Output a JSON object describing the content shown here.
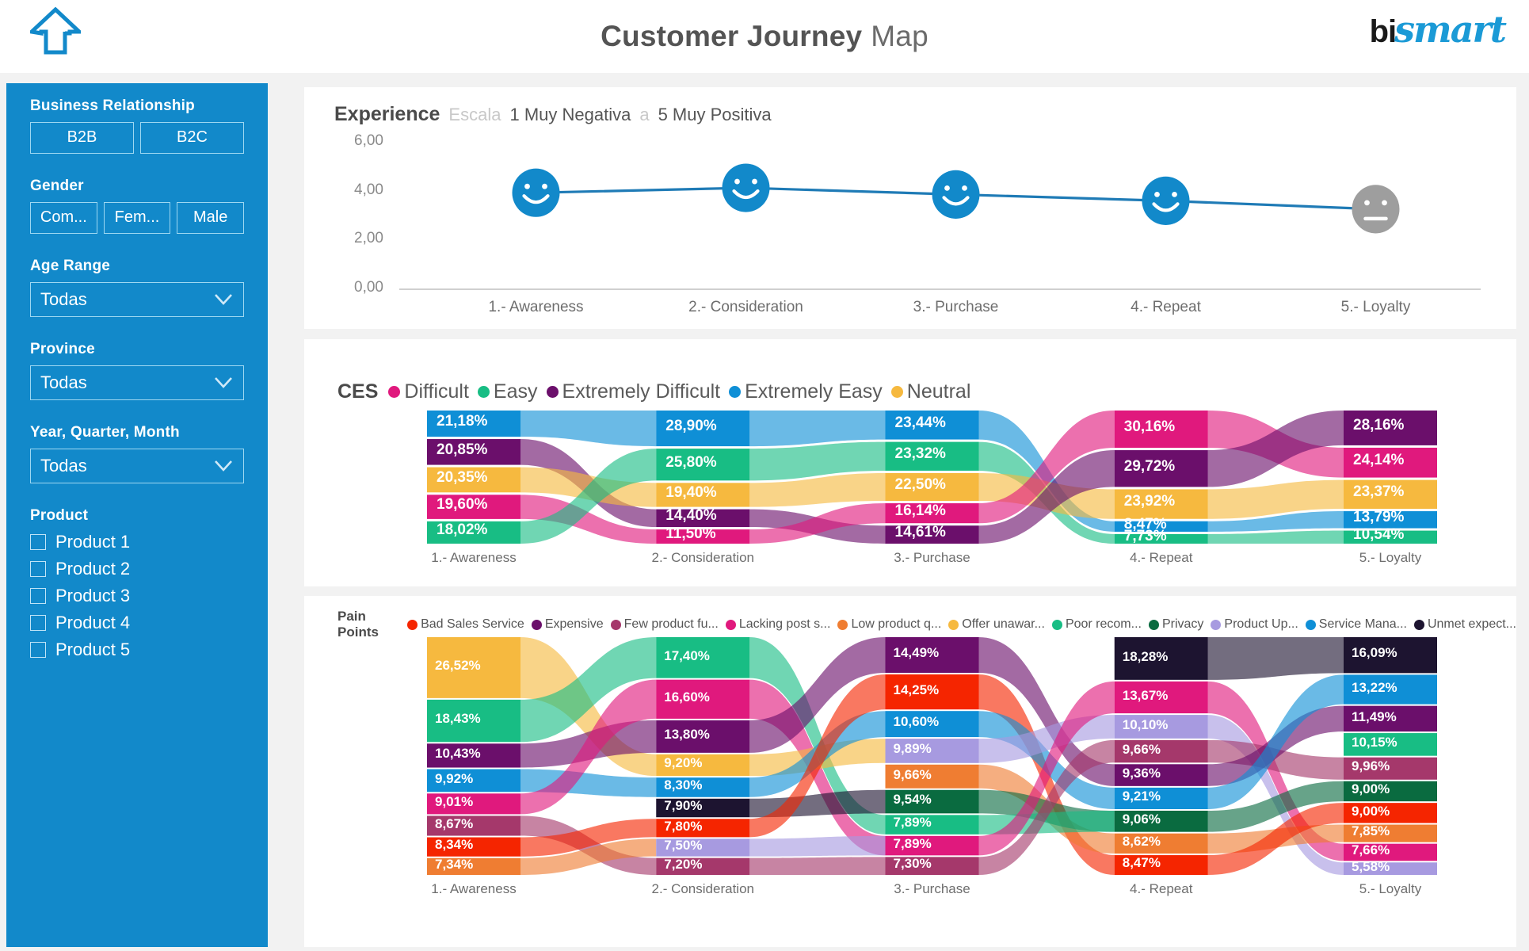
{
  "header": {
    "home_icon": "home-icon",
    "title_bold": "Customer Journey",
    "title_light": "Map",
    "logo_bi": "bi",
    "logo_smart": "smart"
  },
  "sidebar": {
    "business_relationship": {
      "label": "Business Relationship",
      "options": [
        "B2B",
        "B2C"
      ]
    },
    "gender": {
      "label": "Gender",
      "options": [
        "Com...",
        "Fem...",
        "Male"
      ]
    },
    "age_range": {
      "label": "Age Range",
      "value": "Todas",
      "icon": "chevron-down-icon"
    },
    "province": {
      "label": "Province",
      "value": "Todas",
      "icon": "chevron-down-icon"
    },
    "period": {
      "label": "Year, Quarter, Month",
      "value": "Todas",
      "icon": "chevron-down-icon"
    },
    "product": {
      "label": "Product",
      "items": [
        {
          "label": "Product 1",
          "checked": false
        },
        {
          "label": "Product 2",
          "checked": false
        },
        {
          "label": "Product 3",
          "checked": false
        },
        {
          "label": "Product 4",
          "checked": false
        },
        {
          "label": "Product 5",
          "checked": false
        }
      ]
    }
  },
  "experience": {
    "title": "Experience",
    "scale_word": "Escala",
    "scale_low": "1 Muy Negativa",
    "scale_sep": "a",
    "scale_high": "5 Muy Positiva"
  },
  "ces": {
    "title": "CES",
    "legend": [
      {
        "label": "Difficult",
        "color": "#e0197d"
      },
      {
        "label": "Easy",
        "color": "#18bd84"
      },
      {
        "label": "Extremely Difficult",
        "color": "#6b0f6b"
      },
      {
        "label": "Extremely Easy",
        "color": "#0f8fd6"
      },
      {
        "label": "Neutral",
        "color": "#f6b93f"
      }
    ]
  },
  "pain_points": {
    "title": "Pain Points",
    "legend": [
      {
        "label": "Bad Sales Service",
        "color": "#f52500"
      },
      {
        "label": "Expensive",
        "color": "#6b0f6b"
      },
      {
        "label": "Few product fu...",
        "color": "#a5386b"
      },
      {
        "label": "Lacking post s...",
        "color": "#e0197d"
      },
      {
        "label": "Low product q...",
        "color": "#ef7d32"
      },
      {
        "label": "Offer unawar...",
        "color": "#f6b93f"
      },
      {
        "label": "Poor recom...",
        "color": "#18bd84"
      },
      {
        "label": "Privacy",
        "color": "#0a6b40"
      },
      {
        "label": "Product Up...",
        "color": "#a79ae0"
      },
      {
        "label": "Service Mana...",
        "color": "#0f8fd6"
      },
      {
        "label": "Unmet expect...",
        "color": "#1d1430"
      }
    ]
  },
  "chart_data": [
    {
      "type": "line",
      "title": "Experience",
      "xlabel": "",
      "ylabel": "",
      "ylim": [
        0,
        6
      ],
      "yticks": [
        "0,00",
        "2,00",
        "4,00",
        "6,00"
      ],
      "categories": [
        "1.- Awareness",
        "2.- Consideration",
        "3.- Purchase",
        "4.- Repeat",
        "5.- Loyalty"
      ],
      "values": [
        3.95,
        4.15,
        3.88,
        3.62,
        3.28
      ],
      "markers": [
        {
          "mood": "happy",
          "color": "#1289ca"
        },
        {
          "mood": "happy",
          "color": "#1289ca"
        },
        {
          "mood": "happy",
          "color": "#1289ca"
        },
        {
          "mood": "happy",
          "color": "#1289ca"
        },
        {
          "mood": "neutral",
          "color": "#9e9e9e"
        }
      ],
      "line_color": "#1f7bb6",
      "grid": false
    },
    {
      "type": "sankey",
      "title": "CES",
      "stages": [
        "1.- Awareness",
        "2.- Consideration",
        "3.- Purchase",
        "4.- Repeat",
        "5.- Loyalty"
      ],
      "nodes": [
        [
          {
            "label": "21,18%",
            "value": 21.18,
            "color": "#0f8fd6",
            "series": "Extremely Easy"
          },
          {
            "label": "20,85%",
            "value": 20.85,
            "color": "#6b0f6b",
            "series": "Extremely Difficult"
          },
          {
            "label": "20,35%",
            "value": 20.35,
            "color": "#f6b93f",
            "series": "Neutral"
          },
          {
            "label": "19,60%",
            "value": 19.6,
            "color": "#e0197d",
            "series": "Difficult"
          },
          {
            "label": "18,02%",
            "value": 18.02,
            "color": "#18bd84",
            "series": "Easy"
          }
        ],
        [
          {
            "label": "28,90%",
            "value": 28.9,
            "color": "#0f8fd6",
            "series": "Extremely Easy"
          },
          {
            "label": "25,80%",
            "value": 25.8,
            "color": "#18bd84",
            "series": "Easy"
          },
          {
            "label": "19,40%",
            "value": 19.4,
            "color": "#f6b93f",
            "series": "Neutral"
          },
          {
            "label": "14,40%",
            "value": 14.4,
            "color": "#6b0f6b",
            "series": "Extremely Difficult"
          },
          {
            "label": "11,50%",
            "value": 11.5,
            "color": "#e0197d",
            "series": "Difficult"
          }
        ],
        [
          {
            "label": "23,44%",
            "value": 23.44,
            "color": "#0f8fd6",
            "series": "Extremely Easy"
          },
          {
            "label": "23,32%",
            "value": 23.32,
            "color": "#18bd84",
            "series": "Easy"
          },
          {
            "label": "22,50%",
            "value": 22.5,
            "color": "#f6b93f",
            "series": "Neutral"
          },
          {
            "label": "16,14%",
            "value": 16.14,
            "color": "#e0197d",
            "series": "Difficult"
          },
          {
            "label": "14,61%",
            "value": 14.61,
            "color": "#6b0f6b",
            "series": "Extremely Difficult"
          }
        ],
        [
          {
            "label": "30,16%",
            "value": 30.16,
            "color": "#e0197d",
            "series": "Difficult"
          },
          {
            "label": "29,72%",
            "value": 29.72,
            "color": "#6b0f6b",
            "series": "Extremely Difficult"
          },
          {
            "label": "23,92%",
            "value": 23.92,
            "color": "#f6b93f",
            "series": "Neutral"
          },
          {
            "label": "8,47%",
            "value": 8.47,
            "color": "#0f8fd6",
            "series": "Extremely Easy"
          },
          {
            "label": "7,73%",
            "value": 7.73,
            "color": "#18bd84",
            "series": "Easy"
          }
        ],
        [
          {
            "label": "28,16%",
            "value": 28.16,
            "color": "#6b0f6b",
            "series": "Extremely Difficult"
          },
          {
            "label": "24,14%",
            "value": 24.14,
            "color": "#e0197d",
            "series": "Difficult"
          },
          {
            "label": "23,37%",
            "value": 23.37,
            "color": "#f6b93f",
            "series": "Neutral"
          },
          {
            "label": "13,79%",
            "value": 13.79,
            "color": "#0f8fd6",
            "series": "Extremely Easy"
          },
          {
            "label": "10,54%",
            "value": 10.54,
            "color": "#18bd84",
            "series": "Easy"
          }
        ]
      ]
    },
    {
      "type": "sankey",
      "title": "Pain Points",
      "stages": [
        "1.- Awareness",
        "2.- Consideration",
        "3.- Purchase",
        "4.- Repeat",
        "5.- Loyalty"
      ],
      "nodes": [
        [
          {
            "label": "26,52%",
            "value": 26.52,
            "color": "#f6b93f",
            "series": "Offer unawar..."
          },
          {
            "label": "18,43%",
            "value": 18.43,
            "color": "#18bd84",
            "series": "Poor recom..."
          },
          {
            "label": "10,43%",
            "value": 10.43,
            "color": "#6b0f6b",
            "series": "Expensive"
          },
          {
            "label": "9,92%",
            "value": 9.92,
            "color": "#0f8fd6",
            "series": "Service Mana..."
          },
          {
            "label": "9,01%",
            "value": 9.01,
            "color": "#e0197d",
            "series": "Lacking post s..."
          },
          {
            "label": "8,67%",
            "value": 8.67,
            "color": "#a5386b",
            "series": "Few product fu..."
          },
          {
            "label": "8,34%",
            "value": 8.34,
            "color": "#f52500",
            "series": "Bad Sales Service"
          },
          {
            "label": "7,34%",
            "value": 7.34,
            "color": "#ef7d32",
            "series": "Low product q..."
          }
        ],
        [
          {
            "label": "17,40%",
            "value": 17.4,
            "color": "#18bd84",
            "series": "Poor recom..."
          },
          {
            "label": "16,60%",
            "value": 16.6,
            "color": "#e0197d",
            "series": "Lacking post s..."
          },
          {
            "label": "13,80%",
            "value": 13.8,
            "color": "#6b0f6b",
            "series": "Expensive"
          },
          {
            "label": "9,20%",
            "value": 9.2,
            "color": "#f6b93f",
            "series": "Offer unawar..."
          },
          {
            "label": "8,30%",
            "value": 8.3,
            "color": "#0f8fd6",
            "series": "Service Mana..."
          },
          {
            "label": "7,90%",
            "value": 7.9,
            "color": "#1d1430",
            "series": "Unmet expect..."
          },
          {
            "label": "7,80%",
            "value": 7.8,
            "color": "#f52500",
            "series": "Bad Sales Service"
          },
          {
            "label": "7,50%",
            "value": 7.5,
            "color": "#a79ae0",
            "series": "Product Up..."
          },
          {
            "label": "7,20%",
            "value": 7.2,
            "color": "#a5386b",
            "series": "Few product fu..."
          }
        ],
        [
          {
            "label": "14,49%",
            "value": 14.49,
            "color": "#6b0f6b",
            "series": "Expensive"
          },
          {
            "label": "14,25%",
            "value": 14.25,
            "color": "#f52500",
            "series": "Bad Sales Service"
          },
          {
            "label": "10,60%",
            "value": 10.6,
            "color": "#0f8fd6",
            "series": "Service Mana..."
          },
          {
            "label": "9,89%",
            "value": 9.89,
            "color": "#a79ae0",
            "series": "Product Up..."
          },
          {
            "label": "9,66%",
            "value": 9.66,
            "color": "#ef7d32",
            "series": "Low product q..."
          },
          {
            "label": "9,54%",
            "value": 9.54,
            "color": "#0a6b40",
            "series": "Privacy"
          },
          {
            "label": "7,89%",
            "value": 7.89,
            "color": "#18bd84",
            "series": "Poor recom..."
          },
          {
            "label": "7,89%",
            "value": 7.89,
            "color": "#e0197d",
            "series": "Lacking post s..."
          },
          {
            "label": "7,30%",
            "value": 7.3,
            "color": "#a5386b",
            "series": "Few product fu..."
          }
        ],
        [
          {
            "label": "18,28%",
            "value": 18.28,
            "color": "#1d1430",
            "series": "Unmet expect..."
          },
          {
            "label": "13,67%",
            "value": 13.67,
            "color": "#e0197d",
            "series": "Lacking post s..."
          },
          {
            "label": "10,10%",
            "value": 10.1,
            "color": "#a79ae0",
            "series": "Product Up..."
          },
          {
            "label": "9,66%",
            "value": 9.66,
            "color": "#a5386b",
            "series": "Few product fu..."
          },
          {
            "label": "9,36%",
            "value": 9.36,
            "color": "#6b0f6b",
            "series": "Expensive"
          },
          {
            "label": "9,21%",
            "value": 9.21,
            "color": "#0f8fd6",
            "series": "Service Mana..."
          },
          {
            "label": "9,06%",
            "value": 9.06,
            "color": "#0a6b40",
            "series": "Privacy"
          },
          {
            "label": "8,62%",
            "value": 8.62,
            "color": "#ef7d32",
            "series": "Low product q..."
          },
          {
            "label": "8,47%",
            "value": 8.47,
            "color": "#f52500",
            "series": "Bad Sales Service"
          }
        ],
        [
          {
            "label": "16,09%",
            "value": 16.09,
            "color": "#1d1430",
            "series": "Unmet expect..."
          },
          {
            "label": "13,22%",
            "value": 13.22,
            "color": "#0f8fd6",
            "series": "Service Mana..."
          },
          {
            "label": "11,49%",
            "value": 11.49,
            "color": "#6b0f6b",
            "series": "Expensive"
          },
          {
            "label": "10,15%",
            "value": 10.15,
            "color": "#18bd84",
            "series": "Poor recom..."
          },
          {
            "label": "9,96%",
            "value": 9.96,
            "color": "#a5386b",
            "series": "Few product fu..."
          },
          {
            "label": "9,00%",
            "value": 9.0,
            "color": "#0a6b40",
            "series": "Privacy"
          },
          {
            "label": "9,00%",
            "value": 9.0,
            "color": "#f52500",
            "series": "Bad Sales Service"
          },
          {
            "label": "7,85%",
            "value": 7.85,
            "color": "#ef7d32",
            "series": "Low product q..."
          },
          {
            "label": "7,66%",
            "value": 7.66,
            "color": "#e0197d",
            "series": "Lacking post s..."
          },
          {
            "label": "5,58%",
            "value": 5.58,
            "color": "#a79ae0",
            "series": "Product Up..."
          }
        ]
      ]
    }
  ]
}
